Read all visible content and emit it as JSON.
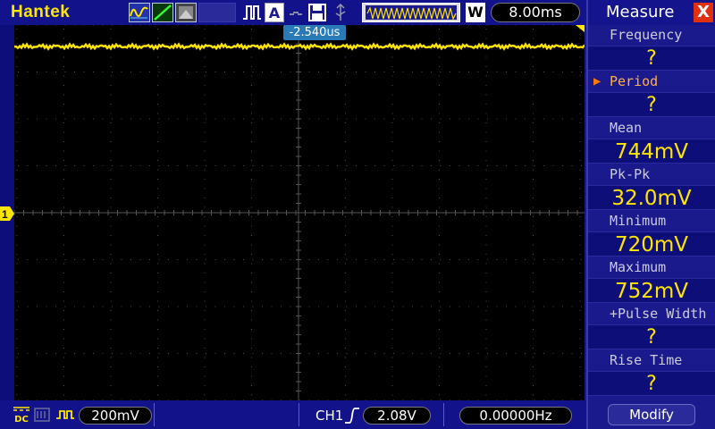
{
  "brand": "Hantek",
  "toolbar": {
    "auto_label": "A",
    "w_badge": "W",
    "timebase": "8.00ms"
  },
  "trigger_position": "-2.540us",
  "channel": {
    "marker": "1",
    "coupling": "DC",
    "volts_per_div": "200mV",
    "trigger_source": "CH1",
    "trigger_level": "2.08V",
    "frequency": "0.00000Hz"
  },
  "measure": {
    "title": "Measure",
    "close_label": "X",
    "items": [
      {
        "label": "Frequency",
        "value": "?",
        "selected": false
      },
      {
        "label": "Period",
        "value": "?",
        "selected": true
      },
      {
        "label": "Mean",
        "value": "744mV",
        "selected": false
      },
      {
        "label": "Pk-Pk",
        "value": "32.0mV",
        "selected": false
      },
      {
        "label": "Minimum",
        "value": "720mV",
        "selected": false
      },
      {
        "label": "Maximum",
        "value": "752mV",
        "selected": false
      },
      {
        "label": "+Pulse Width",
        "value": "?",
        "selected": false
      },
      {
        "label": "Rise Time",
        "value": "?",
        "selected": false
      }
    ],
    "modify_label": "Modify"
  },
  "colors": {
    "trace": "#ffe600",
    "background": "#1a1a8c",
    "accent": "#ff7a00"
  }
}
